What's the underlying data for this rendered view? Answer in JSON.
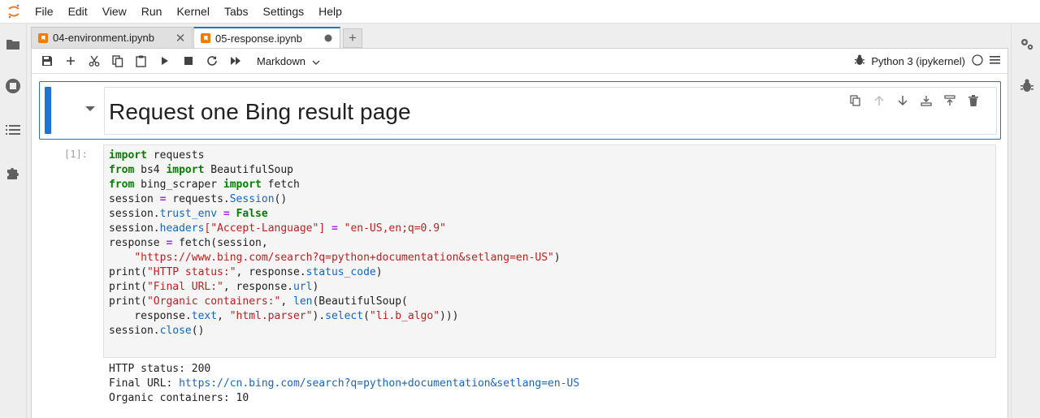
{
  "menu": [
    "File",
    "Edit",
    "View",
    "Run",
    "Kernel",
    "Tabs",
    "Settings",
    "Help"
  ],
  "tabs": [
    {
      "label": "04-environment.ipynb",
      "action": "close-icon"
    },
    {
      "label": "05-response.ipynb",
      "action": "unsaved-dot-icon"
    }
  ],
  "toolbar": {
    "cell_type": "Markdown",
    "kernel_name": "Python 3 (ipykernel)"
  },
  "markdown_cell": {
    "title": "Request one Bing result page"
  },
  "code_cell": {
    "prompt": "[1]:",
    "lines": [
      "import requests",
      "from bs4 import BeautifulSoup",
      "from bing_scraper import fetch",
      "session = requests.Session()",
      "session.trust_env = False",
      "session.headers[\"Accept-Language\"] = \"en-US,en;q=0.9\"",
      "response = fetch(session,",
      "    \"https://www.bing.com/search?q=python+documentation&setlang=en-US\")",
      "print(\"HTTP status:\", response.status_code)",
      "print(\"Final URL:\", response.url)",
      "print(\"Organic containers:\", len(BeautifulSoup(",
      "    response.text, \"html.parser\").select(\"li.b_algo\")))",
      "session.close()"
    ]
  },
  "output": {
    "status_label": "HTTP status: ",
    "status_value": "200",
    "url_label": "Final URL: ",
    "url_value": "https://cn.bing.com/search?q=python+documentation&setlang=en-US",
    "containers_label": "Organic containers: ",
    "containers_value": "10"
  },
  "colors": {
    "accent": "#1976d2",
    "notebook_icon": "#f57c00",
    "keyword": "#008000",
    "string": "#ba2121",
    "attribute": "#1565c0"
  }
}
